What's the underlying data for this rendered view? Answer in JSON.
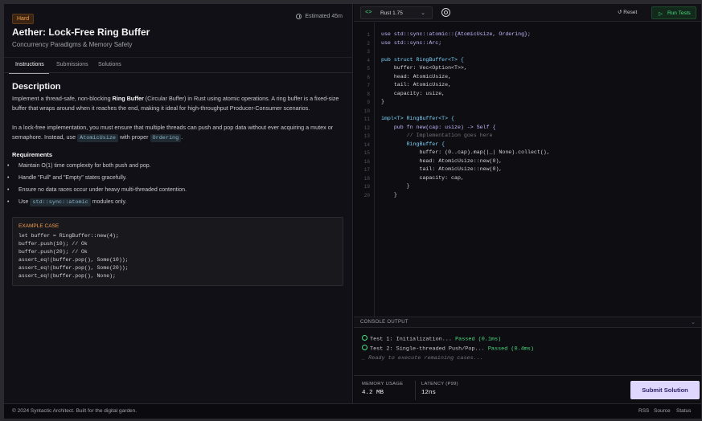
{
  "problem": {
    "difficulty": "Hard",
    "estimated": "Estimated 45m",
    "title": "Aether: Lock-Free Ring Buffer",
    "subtitle": "Concurrency Paradigms & Memory Safety"
  },
  "tabs": [
    "Instructions",
    "Submissions",
    "Solutions"
  ],
  "description": {
    "heading": "Description",
    "p1_before": "Implement a thread-safe, non-blocking ",
    "p1_bold": "Ring Buffer",
    "p1_after": " (Circular Buffer) in Rust using atomic operations. A ring buffer is a fixed-size buffer that wraps around when it reaches the end, making it ideal for high-throughput Producer-Consumer scenarios.",
    "p2_before": "In a lock-free implementation, you must ensure that multiple threads can push and pop data without ever acquiring a mutex or semaphore. Instead, use ",
    "p2_chip1": "AtomicUsize",
    "p2_mid": " with proper ",
    "p2_chip2": "Ordering",
    "p2_after": "."
  },
  "requirements": {
    "heading": "Requirements",
    "items": [
      "Maintain O(1) time complexity for both push and pop.",
      "Handle \"Full\" and \"Empty\" states gracefully.",
      "Ensure no data races occur under heavy multi-threaded contention."
    ],
    "item4_before": "Use ",
    "item4_chip": "std::sync::atomic",
    "item4_after": " modules only."
  },
  "example": {
    "label": "EXAMPLE CASE",
    "code": "let buffer = RingBuffer::new(4);\nbuffer.push(10); // Ok\nbuffer.push(20); // Ok\nassert_eq!(buffer.pop(), Some(10));\nassert_eq!(buffer.pop(), Some(20));\nassert_eq!(buffer.pop(), None);"
  },
  "toolbar": {
    "language": "Rust 1.75",
    "reset": "Reset",
    "run": "Run Tests"
  },
  "editor": {
    "line_numbers": [
      "1",
      "2",
      "3",
      "4",
      "5",
      "6",
      "7",
      "8",
      "9",
      "10",
      "11",
      "12",
      "13",
      "14",
      "15",
      "16",
      "17",
      "18",
      "19",
      "20"
    ],
    "lines": [
      "use std::sync::atomic::{AtomicUsize, Ordering};",
      "use std::sync::Arc;",
      "",
      "pub struct RingBuffer<T> {",
      "    buffer: Vec<Option<T>>,",
      "    head: AtomicUsize,",
      "    tail: AtomicUsize,",
      "    capacity: usize,",
      "}",
      "",
      "impl<T> RingBuffer<T> {",
      "    pub fn new(cap: usize) -> Self {",
      "        // Implementation goes here",
      "        RingBuffer {",
      "            buffer: (0..cap).map(|_| None).collect(),",
      "            head: AtomicUsize::new(0),",
      "            tail: AtomicUsize::new(0),",
      "            capacity: cap,",
      "        }",
      "    }"
    ]
  },
  "console": {
    "header": "CONSOLE OUTPUT",
    "test1": "Test 1: Initialization... ",
    "test1_status": "Passed (0.1ms)",
    "test2": "Test 2: Single-threaded Push/Pop... ",
    "test2_status": "Passed (0.4ms)",
    "ready": "_ Ready to execute remaining cases..."
  },
  "stats": {
    "memory_label": "MEMORY USAGE",
    "memory_value": "4.2 MB",
    "latency_label": "LATENCY (P99)",
    "latency_value": "12ns",
    "submit": "Submit Solution"
  },
  "footer": {
    "copyright": "© 2024 Syntactic Architect. Built for the digital garden.",
    "links": [
      "RSS",
      "Source",
      "Status"
    ]
  },
  "colors": {
    "accent_green": "#4ade80",
    "accent_orange": "#f59e4b",
    "submit_bg": "#e0d7ff"
  }
}
